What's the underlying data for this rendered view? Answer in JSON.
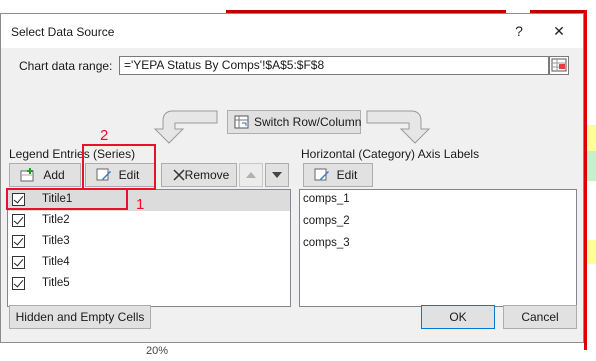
{
  "dialog": {
    "title": "Select Data Source",
    "help_label": "?",
    "close_label": "✕"
  },
  "range": {
    "label": "Chart data range:",
    "value": "='YEPA Status By Comps'!$A$5:$F$8"
  },
  "switch_button": "Switch Row/Column",
  "legend": {
    "heading": "Legend Entries (Series)",
    "add_label": "Add",
    "edit_label": "Edit",
    "remove_label": "Remove",
    "series": [
      {
        "label": "Titile1",
        "checked": true
      },
      {
        "label": "Title2",
        "checked": true
      },
      {
        "label": "Title3",
        "checked": true
      },
      {
        "label": "Title4",
        "checked": true
      },
      {
        "label": "Title5",
        "checked": true
      }
    ]
  },
  "axis": {
    "heading": "Horizontal (Category) Axis Labels",
    "edit_label": "Edit",
    "categories": [
      "comps_1",
      "comps_2",
      "comps_3"
    ]
  },
  "footer": {
    "hidden_label": "Hidden and Empty Cells",
    "ok_label": "OK",
    "cancel_label": "Cancel"
  },
  "annotations": {
    "one": "1",
    "two": "2"
  },
  "background": {
    "cell_text": "20%"
  },
  "colors": {
    "annotation_red": "#e8102a",
    "selected_row": "#cce8ff"
  }
}
